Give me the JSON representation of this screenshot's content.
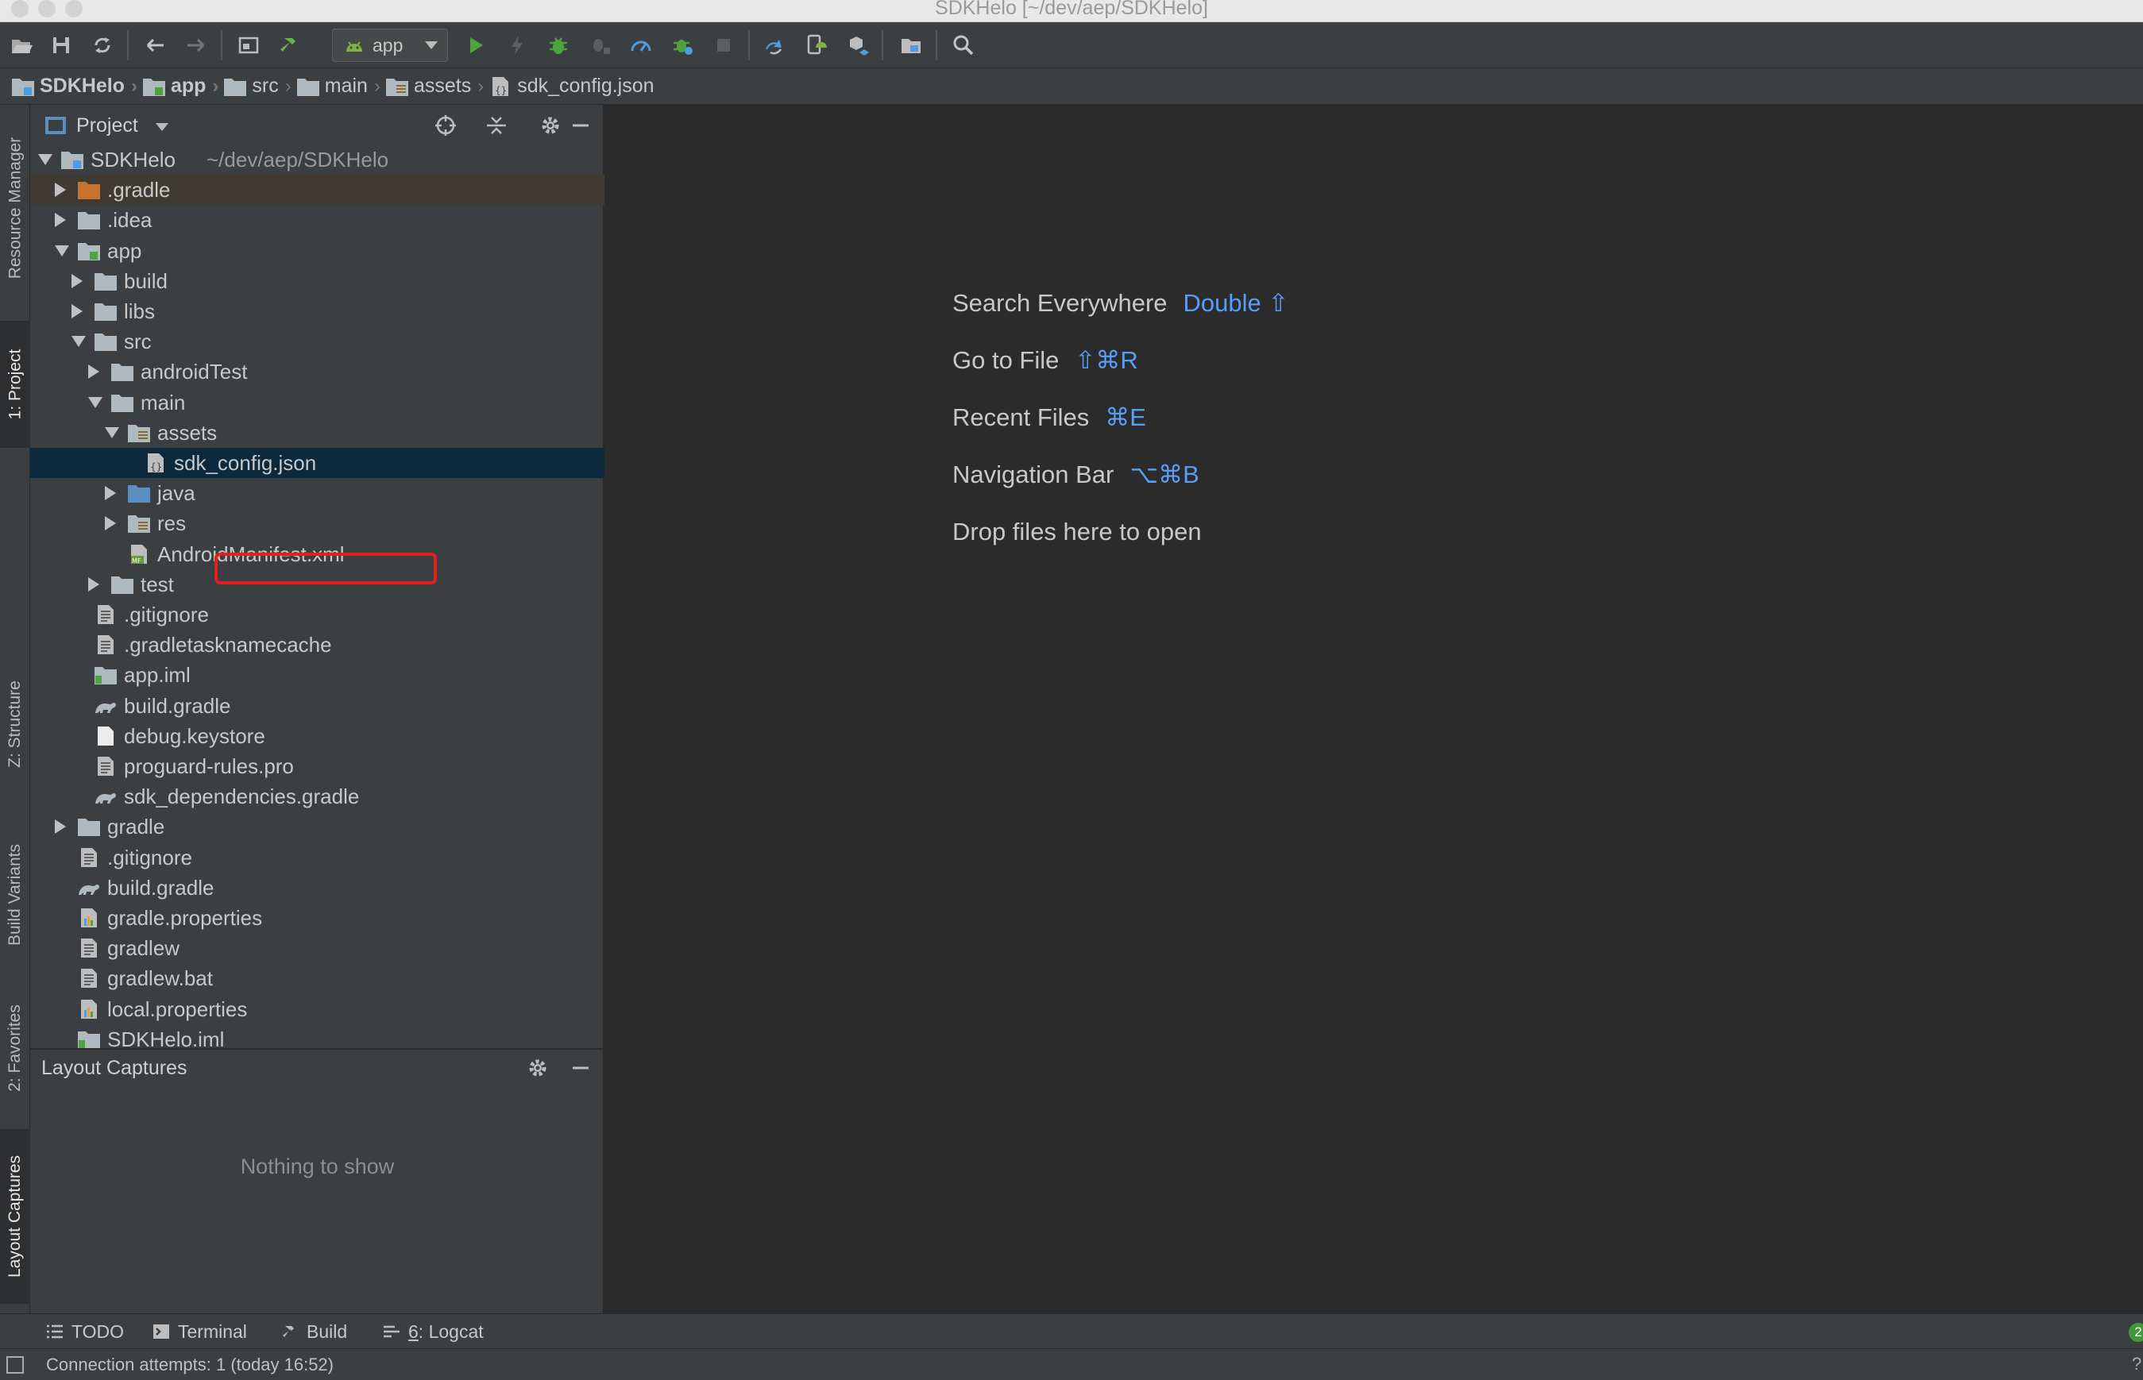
{
  "window": {
    "title": "SDKHelo [~/dev/aep/SDKHelo]"
  },
  "toolbar": {
    "run_config": "app",
    "icons": [
      "open-folder-icon",
      "save-icon",
      "sync-icon",
      "back-icon",
      "forward-icon",
      "window-icon",
      "build-hammer-icon",
      "run-icon",
      "apply-changes-icon",
      "debug-icon",
      "attach-debugger-icon",
      "profile-icon",
      "debug-bug-icon",
      "stop-icon",
      "sync-gradle-icon",
      "avd-manager-icon",
      "sdk-manager-icon",
      "project-structure-icon",
      "search-icon"
    ]
  },
  "breadcrumb": [
    {
      "label": "SDKHelo",
      "icon": "project-folder-icon",
      "bold": true
    },
    {
      "label": "app",
      "icon": "module-folder-icon",
      "bold": true
    },
    {
      "label": "src",
      "icon": "folder-icon",
      "bold": false
    },
    {
      "label": "main",
      "icon": "folder-icon",
      "bold": false
    },
    {
      "label": "assets",
      "icon": "assets-folder-icon",
      "bold": false
    },
    {
      "label": "sdk_config.json",
      "icon": "json-file-icon",
      "bold": false
    }
  ],
  "left_stripe": {
    "tabs": [
      "Resource Manager",
      "1: Project",
      "Z: Structure",
      "Build Variants",
      "2: Favorites",
      "Layout Captures"
    ]
  },
  "project_panel": {
    "title": "Project",
    "root": {
      "name": "SDKHelo",
      "path": "~/dev/aep/SDKHelo"
    },
    "tree": [
      {
        "name": ".gradle",
        "level": 1,
        "expand": "collapsed",
        "icon": "folder-orange"
      },
      {
        "name": ".idea",
        "level": 1,
        "expand": "collapsed",
        "icon": "folder"
      },
      {
        "name": "app",
        "level": 1,
        "expand": "expanded",
        "icon": "module"
      },
      {
        "name": "build",
        "level": 2,
        "expand": "collapsed",
        "icon": "folder"
      },
      {
        "name": "libs",
        "level": 2,
        "expand": "collapsed",
        "icon": "folder"
      },
      {
        "name": "src",
        "level": 2,
        "expand": "expanded",
        "icon": "folder"
      },
      {
        "name": "androidTest",
        "level": 3,
        "expand": "collapsed",
        "icon": "folder"
      },
      {
        "name": "main",
        "level": 3,
        "expand": "expanded",
        "icon": "folder"
      },
      {
        "name": "assets",
        "level": 4,
        "expand": "expanded",
        "icon": "assets"
      },
      {
        "name": "sdk_config.json",
        "level": 5,
        "expand": "none",
        "icon": "json"
      },
      {
        "name": "java",
        "level": 4,
        "expand": "collapsed",
        "icon": "folder-blue"
      },
      {
        "name": "res",
        "level": 4,
        "expand": "collapsed",
        "icon": "res"
      },
      {
        "name": "AndroidManifest.xml",
        "level": 4,
        "expand": "none",
        "icon": "manifest"
      },
      {
        "name": "test",
        "level": 3,
        "expand": "collapsed",
        "icon": "folder"
      },
      {
        "name": ".gitignore",
        "level": 2,
        "expand": "none",
        "icon": "text"
      },
      {
        "name": ".gradletasknamecache",
        "level": 2,
        "expand": "none",
        "icon": "text"
      },
      {
        "name": "app.iml",
        "level": 2,
        "expand": "none",
        "icon": "iml"
      },
      {
        "name": "build.gradle",
        "level": 2,
        "expand": "none",
        "icon": "gradle"
      },
      {
        "name": "debug.keystore",
        "level": 2,
        "expand": "none",
        "icon": "blank"
      },
      {
        "name": "proguard-rules.pro",
        "level": 2,
        "expand": "none",
        "icon": "text"
      },
      {
        "name": "sdk_dependencies.gradle",
        "level": 2,
        "expand": "none",
        "icon": "gradle"
      },
      {
        "name": "gradle",
        "level": 1,
        "expand": "collapsed",
        "icon": "folder"
      },
      {
        "name": ".gitignore",
        "level": 1,
        "expand": "none",
        "icon": "text"
      },
      {
        "name": "build.gradle",
        "level": 1,
        "expand": "none",
        "icon": "gradle"
      },
      {
        "name": "gradle.properties",
        "level": 1,
        "expand": "none",
        "icon": "properties"
      },
      {
        "name": "gradlew",
        "level": 1,
        "expand": "none",
        "icon": "text"
      },
      {
        "name": "gradlew.bat",
        "level": 1,
        "expand": "none",
        "icon": "text"
      },
      {
        "name": "local.properties",
        "level": 1,
        "expand": "none",
        "icon": "properties"
      },
      {
        "name": "SDKHelo.iml",
        "level": 1,
        "expand": "none",
        "icon": "iml"
      }
    ]
  },
  "layout_captures": {
    "title": "Layout Captures",
    "empty_text": "Nothing to show"
  },
  "editor": {
    "hints": [
      {
        "label": "Search Everywhere",
        "shortcut": "Double ⇧"
      },
      {
        "label": "Go to File",
        "shortcut": "⇧⌘R"
      },
      {
        "label": "Recent Files",
        "shortcut": "⌘E"
      },
      {
        "label": "Navigation Bar",
        "shortcut": "⌥⌘B"
      },
      {
        "label": "Drop files here to open",
        "shortcut": ""
      }
    ]
  },
  "bottom_tabs": {
    "todo": "TODO",
    "terminal": "Terminal",
    "build": "Build",
    "logcat_num": "6",
    "logcat": ": Logcat",
    "event_count": "2"
  },
  "status": {
    "text": "Connection attempts: 1 (today 16:52)",
    "help": "?"
  },
  "colors": {
    "selection": "#0d293e",
    "highlight_box": "#e0201c",
    "shortcut": "#589df6",
    "gitignored_row": "#3f3b33"
  }
}
